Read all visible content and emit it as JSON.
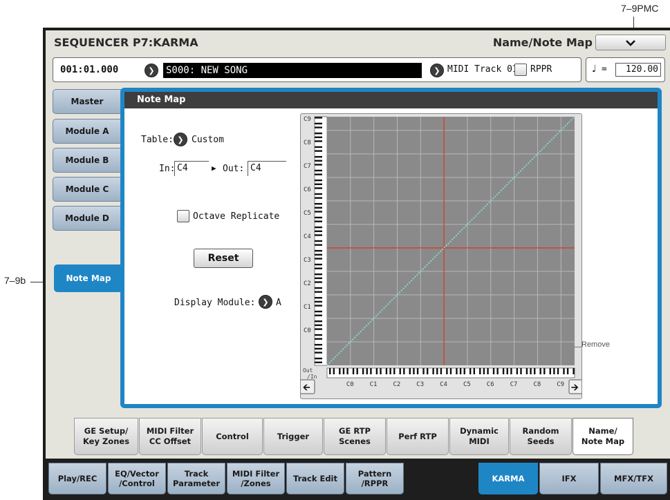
{
  "callouts": {
    "top_right": "7–9PMC",
    "left": "7–9b"
  },
  "header": {
    "title": "SEQUENCER P7:KARMA",
    "page_name": "Name/Note Map"
  },
  "infobar": {
    "location": "001:01.000",
    "song": "S000: NEW SONG",
    "midi_track": "MIDI Track 01:",
    "rppr_label": "RPPR",
    "tempo_symbol": "♩",
    "tempo_eq": "=",
    "tempo": "120.00"
  },
  "side_tabs": [
    "Master",
    "Module A",
    "Module B",
    "Module C",
    "Module D",
    "Note Map"
  ],
  "panel": {
    "header": "Note Map",
    "table_label": "Table:",
    "table_value": "Custom",
    "in_label": "In:",
    "in_value": "C4",
    "out_label": "Out:",
    "out_value": "C4",
    "octave_replicate": "Octave Replicate",
    "reset": "Reset",
    "display_module_label": "Display Module:",
    "display_module_value": "A"
  },
  "graph": {
    "y_labels": [
      "C9",
      "C8",
      "C7",
      "C6",
      "C5",
      "C4",
      "C3",
      "C2",
      "C1",
      "C0"
    ],
    "x_labels": [
      "C0",
      "C1",
      "C2",
      "C3",
      "C4",
      "C5",
      "C6",
      "C7",
      "C8",
      "C9"
    ],
    "out_label": "Out",
    "in_label": "/In",
    "remove_label": "Remove",
    "cursor_note": "C4",
    "colors": {
      "plot_bg": "#8a8a8a",
      "grid": "#b8b8b8",
      "cursor": "#d23a28",
      "mapping": "#8ad6d6"
    }
  },
  "bottom_tabs": [
    {
      "l1": "GE Setup/",
      "l2": "Key Zones"
    },
    {
      "l1": "MIDI Filter",
      "l2": "CC Offset"
    },
    {
      "l1": "Control",
      "l2": ""
    },
    {
      "l1": "Trigger",
      "l2": ""
    },
    {
      "l1": "GE RTP",
      "l2": "Scenes"
    },
    {
      "l1": "Perf RTP",
      "l2": ""
    },
    {
      "l1": "Dynamic",
      "l2": "MIDI"
    },
    {
      "l1": "Random",
      "l2": "Seeds"
    },
    {
      "l1": "Name/",
      "l2": "Note Map"
    }
  ],
  "mode_tabs": [
    {
      "l1": "Play/REC",
      "l2": ""
    },
    {
      "l1": "EQ/Vector",
      "l2": "/Control"
    },
    {
      "l1": "Track",
      "l2": "Parameter"
    },
    {
      "l1": "MIDI Filter",
      "l2": "/Zones"
    },
    {
      "l1": "Track Edit",
      "l2": ""
    },
    {
      "l1": "Pattern",
      "l2": "/RPPR"
    },
    {
      "l1": "KARMA",
      "l2": ""
    },
    {
      "l1": "IFX",
      "l2": ""
    },
    {
      "l1": "MFX/TFX",
      "l2": ""
    }
  ],
  "colors": {
    "accent": "#1f86c6",
    "tab_inactive": "#b4c4d4"
  }
}
